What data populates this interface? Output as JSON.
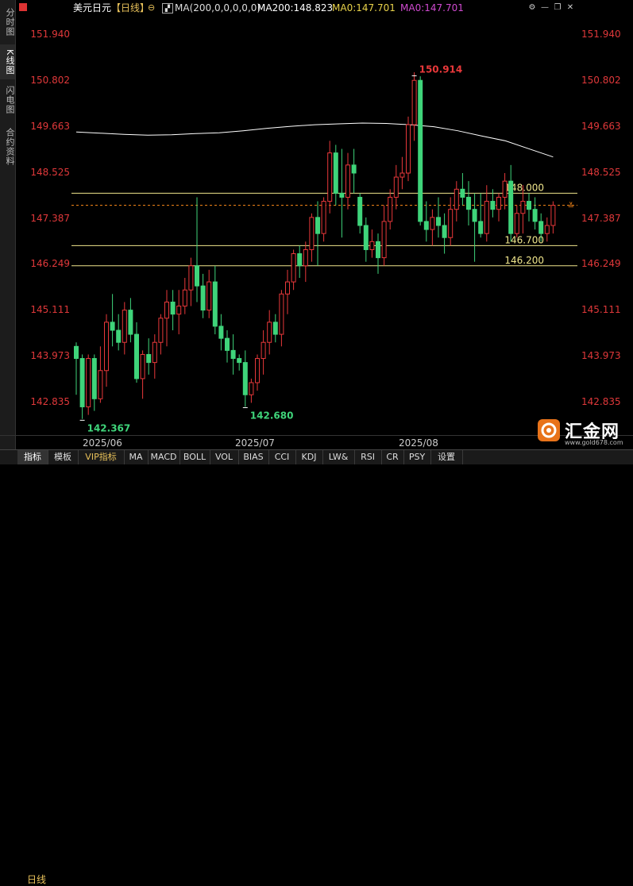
{
  "sidebar": {
    "tabs": [
      {
        "label": "分时图"
      },
      {
        "label": "K线图"
      },
      {
        "label": "闪电图"
      },
      {
        "label": "合约资料"
      }
    ]
  },
  "header": {
    "symbol": "美元日元",
    "period": "【日线】",
    "indicator_params": "MA(200,0,0,0,0,0)",
    "ma200": "MA200:148.823",
    "ma0_a": "MA0:147.701",
    "ma0_b": "MA0:147.701",
    "colors": {
      "ma200": "#ffffff",
      "ma0_a": "#e8d24a",
      "ma0_b": "#d04ad0"
    }
  },
  "x_axis": {
    "period_label": "日线",
    "labels": [
      "2025/06",
      "2025/07",
      "2025/08"
    ]
  },
  "bottom_tabs": [
    {
      "label": "指标",
      "active": true
    },
    {
      "label": "模板"
    },
    {
      "label": "VIP指标",
      "vip": true
    },
    {
      "label": "MA"
    },
    {
      "label": "MACD"
    },
    {
      "label": "BOLL"
    },
    {
      "label": "VOL"
    },
    {
      "label": "BIAS"
    },
    {
      "label": "CCI"
    },
    {
      "label": "KDJ"
    },
    {
      "label": "LW&"
    },
    {
      "label": "RSI"
    },
    {
      "label": "CR"
    },
    {
      "label": "PSY"
    },
    {
      "label": "设置"
    }
  ],
  "logo": {
    "text": "汇金网",
    "url_text": "www.gold678.com"
  },
  "colors": {
    "up": "#e8383a",
    "down": "#3fd47a",
    "price_text": "#e0383a",
    "level_line": "#f0e68c",
    "current_line": "#ff8c1a"
  },
  "chart_data": {
    "type": "candlestick",
    "ylim": [
      142.0,
      152.4
    ],
    "y_ticks": [
      "151.940",
      "150.802",
      "149.663",
      "148.525",
      "147.387",
      "146.249",
      "145.111",
      "143.973",
      "142.835"
    ],
    "grid": false,
    "candles": [
      [
        144.2,
        144.3,
        143.0,
        143.9
      ],
      [
        143.9,
        144.0,
        142.4,
        142.7
      ],
      [
        142.7,
        144.0,
        142.5,
        143.9
      ],
      [
        143.9,
        144.0,
        142.6,
        142.9
      ],
      [
        142.9,
        144.2,
        142.8,
        143.6
      ],
      [
        143.6,
        145.0,
        143.2,
        144.8
      ],
      [
        144.8,
        145.5,
        144.2,
        144.6
      ],
      [
        144.6,
        145.0,
        144.1,
        144.3
      ],
      [
        144.3,
        145.3,
        144.0,
        145.1
      ],
      [
        145.1,
        145.4,
        144.3,
        144.5
      ],
      [
        144.5,
        144.8,
        143.3,
        143.4
      ],
      [
        143.4,
        144.1,
        142.9,
        144.0
      ],
      [
        144.0,
        144.4,
        143.5,
        143.8
      ],
      [
        143.8,
        144.5,
        143.4,
        144.3
      ],
      [
        144.3,
        145.0,
        144.0,
        144.9
      ],
      [
        144.9,
        145.6,
        144.2,
        145.3
      ],
      [
        145.3,
        145.6,
        144.6,
        145.0
      ],
      [
        145.0,
        145.6,
        144.5,
        145.2
      ],
      [
        145.2,
        145.9,
        145.0,
        145.6
      ],
      [
        145.6,
        146.4,
        145.2,
        146.2
      ],
      [
        146.2,
        147.9,
        145.3,
        145.7
      ],
      [
        145.7,
        146.0,
        144.9,
        145.1
      ],
      [
        145.1,
        146.1,
        144.9,
        145.8
      ],
      [
        145.8,
        146.2,
        144.5,
        144.7
      ],
      [
        144.7,
        145.0,
        144.1,
        144.4
      ],
      [
        144.4,
        144.6,
        143.8,
        144.1
      ],
      [
        144.1,
        144.5,
        143.5,
        143.9
      ],
      [
        143.9,
        144.0,
        143.6,
        143.8
      ],
      [
        143.8,
        144.1,
        142.7,
        143.0
      ],
      [
        143.0,
        143.4,
        142.8,
        143.3
      ],
      [
        143.3,
        144.0,
        143.1,
        143.9
      ],
      [
        143.9,
        144.6,
        143.5,
        144.3
      ],
      [
        144.3,
        145.1,
        144.0,
        144.8
      ],
      [
        144.8,
        145.0,
        144.3,
        144.5
      ],
      [
        144.5,
        145.6,
        144.2,
        145.5
      ],
      [
        145.5,
        146.1,
        145.0,
        145.8
      ],
      [
        145.8,
        146.6,
        145.6,
        146.5
      ],
      [
        146.5,
        146.7,
        145.9,
        146.2
      ],
      [
        146.2,
        146.8,
        145.8,
        146.6
      ],
      [
        146.6,
        147.5,
        146.3,
        147.4
      ],
      [
        147.4,
        147.8,
        146.2,
        147.0
      ],
      [
        147.0,
        147.9,
        146.8,
        147.8
      ],
      [
        147.8,
        149.3,
        147.5,
        149.0
      ],
      [
        149.0,
        149.2,
        147.7,
        148.0
      ],
      [
        148.0,
        149.1,
        146.9,
        147.9
      ],
      [
        147.9,
        149.0,
        147.6,
        148.7
      ],
      [
        148.7,
        149.1,
        148.0,
        148.5
      ],
      [
        147.9,
        148.0,
        147.0,
        147.2
      ],
      [
        147.2,
        147.4,
        146.3,
        146.6
      ],
      [
        146.6,
        147.1,
        146.4,
        146.8
      ],
      [
        146.8,
        147.0,
        146.0,
        146.4
      ],
      [
        146.4,
        147.7,
        146.2,
        147.3
      ],
      [
        147.3,
        148.1,
        147.1,
        147.9
      ],
      [
        147.9,
        148.7,
        147.6,
        148.4
      ],
      [
        148.4,
        148.9,
        148.1,
        148.5
      ],
      [
        148.5,
        149.9,
        148.3,
        149.7
      ],
      [
        149.7,
        151.0,
        149.3,
        150.8
      ],
      [
        150.8,
        150.9,
        147.2,
        147.3
      ],
      [
        147.3,
        147.8,
        146.8,
        147.1
      ],
      [
        147.1,
        147.6,
        146.7,
        147.4
      ],
      [
        147.4,
        147.9,
        146.9,
        147.2
      ],
      [
        147.2,
        147.5,
        146.5,
        146.9
      ],
      [
        146.9,
        147.9,
        146.7,
        147.6
      ],
      [
        147.6,
        148.3,
        147.3,
        148.1
      ],
      [
        148.1,
        148.5,
        147.7,
        147.9
      ],
      [
        147.9,
        148.3,
        147.2,
        147.6
      ],
      [
        147.6,
        148.0,
        146.3,
        147.3
      ],
      [
        147.3,
        148.0,
        146.9,
        147.0
      ],
      [
        147.0,
        148.2,
        146.8,
        147.8
      ],
      [
        147.8,
        148.1,
        147.4,
        147.6
      ],
      [
        147.6,
        148.0,
        147.3,
        147.9
      ],
      [
        147.9,
        148.5,
        147.6,
        148.3
      ],
      [
        148.3,
        148.7,
        146.8,
        147.0
      ],
      [
        147.0,
        147.7,
        146.9,
        147.5
      ],
      [
        147.5,
        148.2,
        147.0,
        147.8
      ],
      [
        147.8,
        148.0,
        147.3,
        147.6
      ],
      [
        147.6,
        147.9,
        147.1,
        147.3
      ],
      [
        147.3,
        147.5,
        146.8,
        147.0
      ],
      [
        147.0,
        147.4,
        146.8,
        147.2
      ],
      [
        147.2,
        147.8,
        147.0,
        147.7
      ]
    ],
    "ma200": [
      149.52,
      149.49,
      149.46,
      149.44,
      149.45,
      149.48,
      149.5,
      149.55,
      149.61,
      149.66,
      149.7,
      149.72,
      149.74,
      149.73,
      149.7,
      149.65,
      149.55,
      149.42,
      149.3,
      149.1,
      148.9
    ],
    "levels": [
      {
        "value": 148.0,
        "label": "148.000"
      },
      {
        "value": 146.7,
        "label": "146.700"
      },
      {
        "value": 146.2,
        "label": "146.200"
      }
    ],
    "current_price": 147.701,
    "annotations": [
      {
        "text": "150.914",
        "value": 150.914,
        "candle_index": 56,
        "color": "#e8383a"
      },
      {
        "text": "142.367",
        "value": 142.367,
        "candle_index": 1,
        "color": "#3fd47a"
      },
      {
        "text": "142.680",
        "value": 142.68,
        "candle_index": 28,
        "color": "#3fd47a"
      }
    ]
  }
}
